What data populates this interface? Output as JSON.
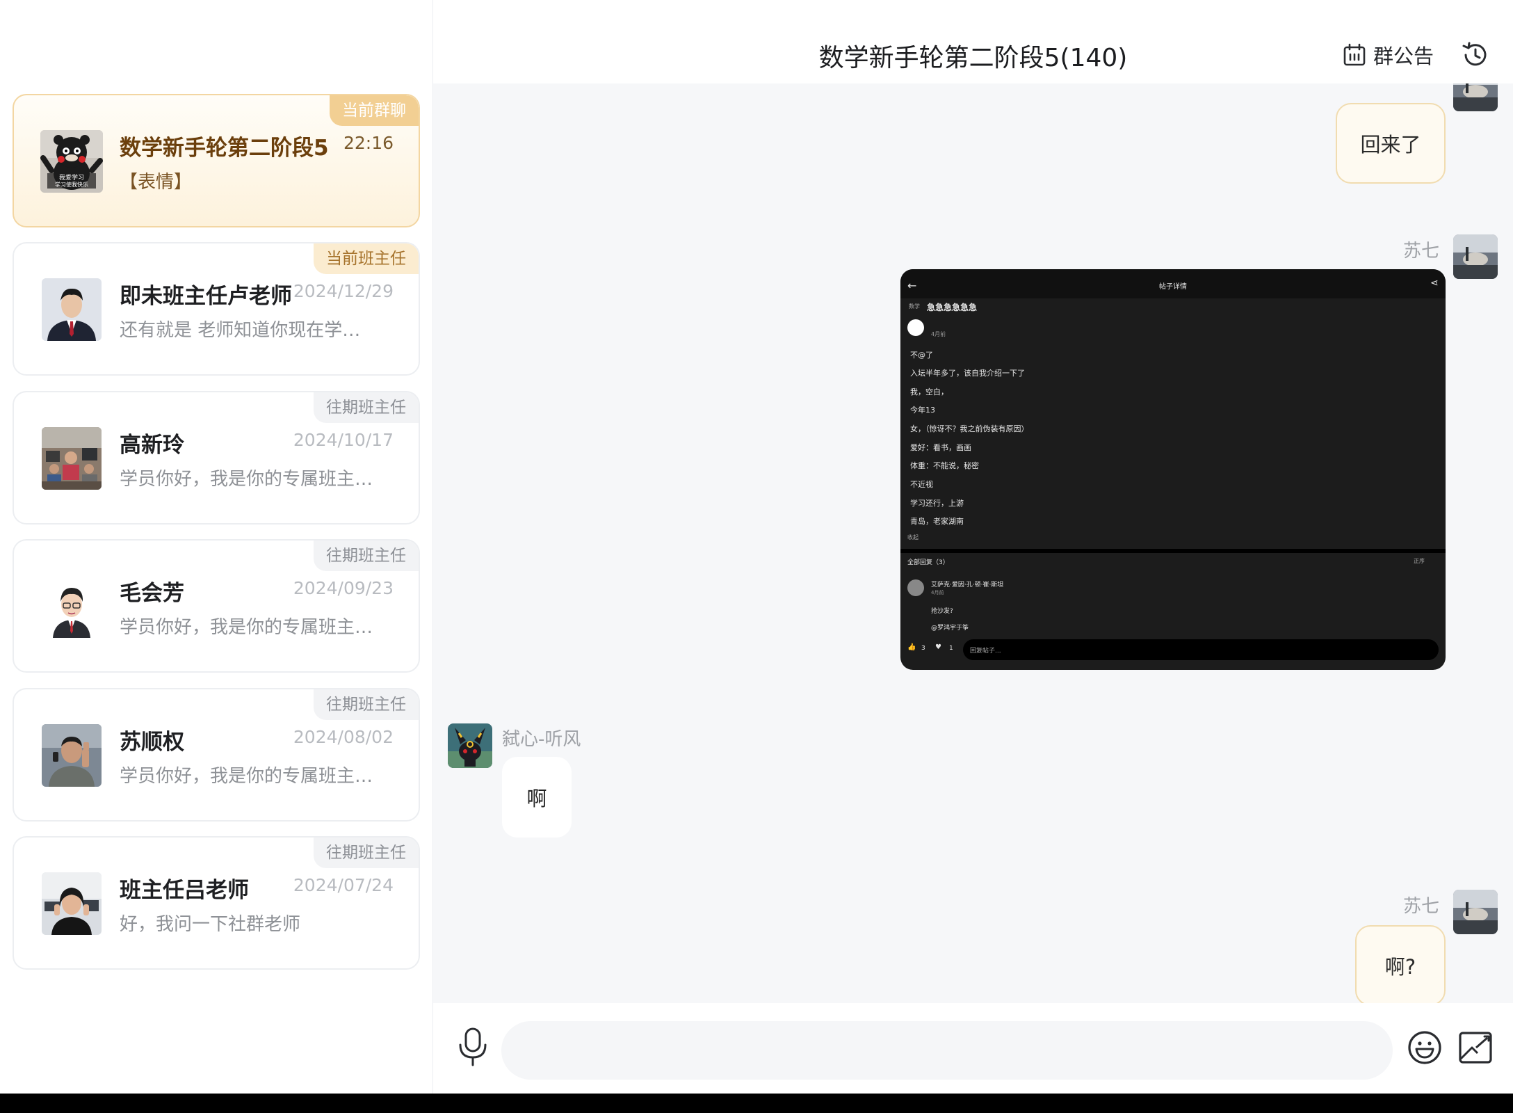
{
  "sidebar": {
    "conversations": [
      {
        "name": "数学新手轮第二阶段5",
        "time": "22:16",
        "preview": "【表情】",
        "tag": "当前群聊",
        "active": true
      },
      {
        "name": "即未班主任卢老师",
        "time": "2024/12/29",
        "preview": "还有就是 老师知道你现在学…",
        "tag": "当前班主任"
      },
      {
        "name": "高新玲",
        "time": "2024/10/17",
        "preview": "学员你好，我是你的专属班主…",
        "tag": "往期班主任"
      },
      {
        "name": "毛会芳",
        "time": "2024/09/23",
        "preview": "学员你好，我是你的专属班主…",
        "tag": "往期班主任"
      },
      {
        "name": "苏顺权",
        "time": "2024/08/02",
        "preview": "学员你好，我是你的专属班主…",
        "tag": "往期班主任"
      },
      {
        "name": "班主任吕老师",
        "time": "2024/07/24",
        "preview": "好，我问一下社群老师",
        "tag": "往期班主任"
      }
    ],
    "kumamon_caption": "我爱学习\n学习使我快乐"
  },
  "chat": {
    "title": "数学新手轮第二阶段5(140)",
    "notice_label": "群公告",
    "messages": [
      {
        "sender": "苏七",
        "text": "回来了",
        "mine": true
      },
      {
        "sender": "苏七",
        "type": "image",
        "mine": true
      },
      {
        "sender": "弑心-听风",
        "text": "啊",
        "mine": false
      },
      {
        "sender": "苏七",
        "text": "啊?",
        "mine": true
      }
    ],
    "screenshot": {
      "header": "帖子详情",
      "subject": "数学",
      "post_title": "急急急急急急",
      "post_time": "4月前",
      "lines": [
        "不@了",
        "入坛半年多了，该自我介绍一下了",
        "我，空白，",
        "今年13",
        "女，（惊讶不？我之前伪装有原因）",
        "爱好：看书，画画",
        "体重：不能说，秘密",
        "不近视",
        "学习还行，上游",
        "青岛，老家湖南"
      ],
      "collapse": "收起",
      "replies_label": "全部回复（3）",
      "sort_label": "正序",
      "reply_user": "艾萨克·爱因·孔·顿·崔·斯坦",
      "reply_time": "4月前",
      "reply_text": "抢沙发?",
      "reply_mention": "@罗鸿宇于筝",
      "likes": "3",
      "hearts": "1",
      "reply_placeholder": "回复帖子..."
    }
  },
  "input": {
    "placeholder": ""
  }
}
